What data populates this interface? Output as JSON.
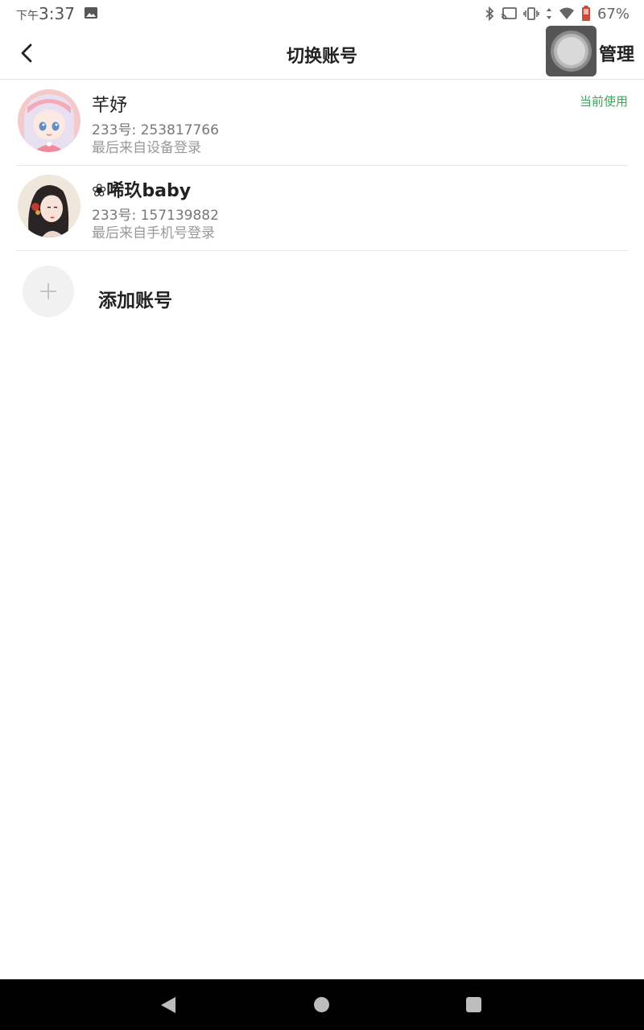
{
  "status_bar": {
    "ampm": "下午",
    "time": "3:37",
    "battery_percent": "67%",
    "icons": [
      "gallery-icon",
      "bluetooth-icon",
      "cast-icon",
      "vibrate-icon",
      "data-arrows-icon",
      "wifi-icon",
      "battery-icon"
    ]
  },
  "header": {
    "title": "切换账号",
    "manage_label": "管理",
    "back_icon": "chevron-left-icon"
  },
  "accounts": [
    {
      "name": "芊妤",
      "id_prefix": "233号: ",
      "id_number": "253817766",
      "login_source": "最后来自设备登录",
      "current_label": "当前使用",
      "avatar": "anime-girl-avatar"
    },
    {
      "name": "❀唏玖baby",
      "id_prefix": "233号: ",
      "id_number": "157139882",
      "login_source": "最后来自手机号登录",
      "avatar": "portrait-avatar"
    }
  ],
  "add_account": {
    "label": "添加账号",
    "icon": "plus-icon"
  },
  "colors": {
    "accent_green": "#3aa757",
    "divider": "#e6e6e6",
    "nav_bar": "#000000"
  }
}
